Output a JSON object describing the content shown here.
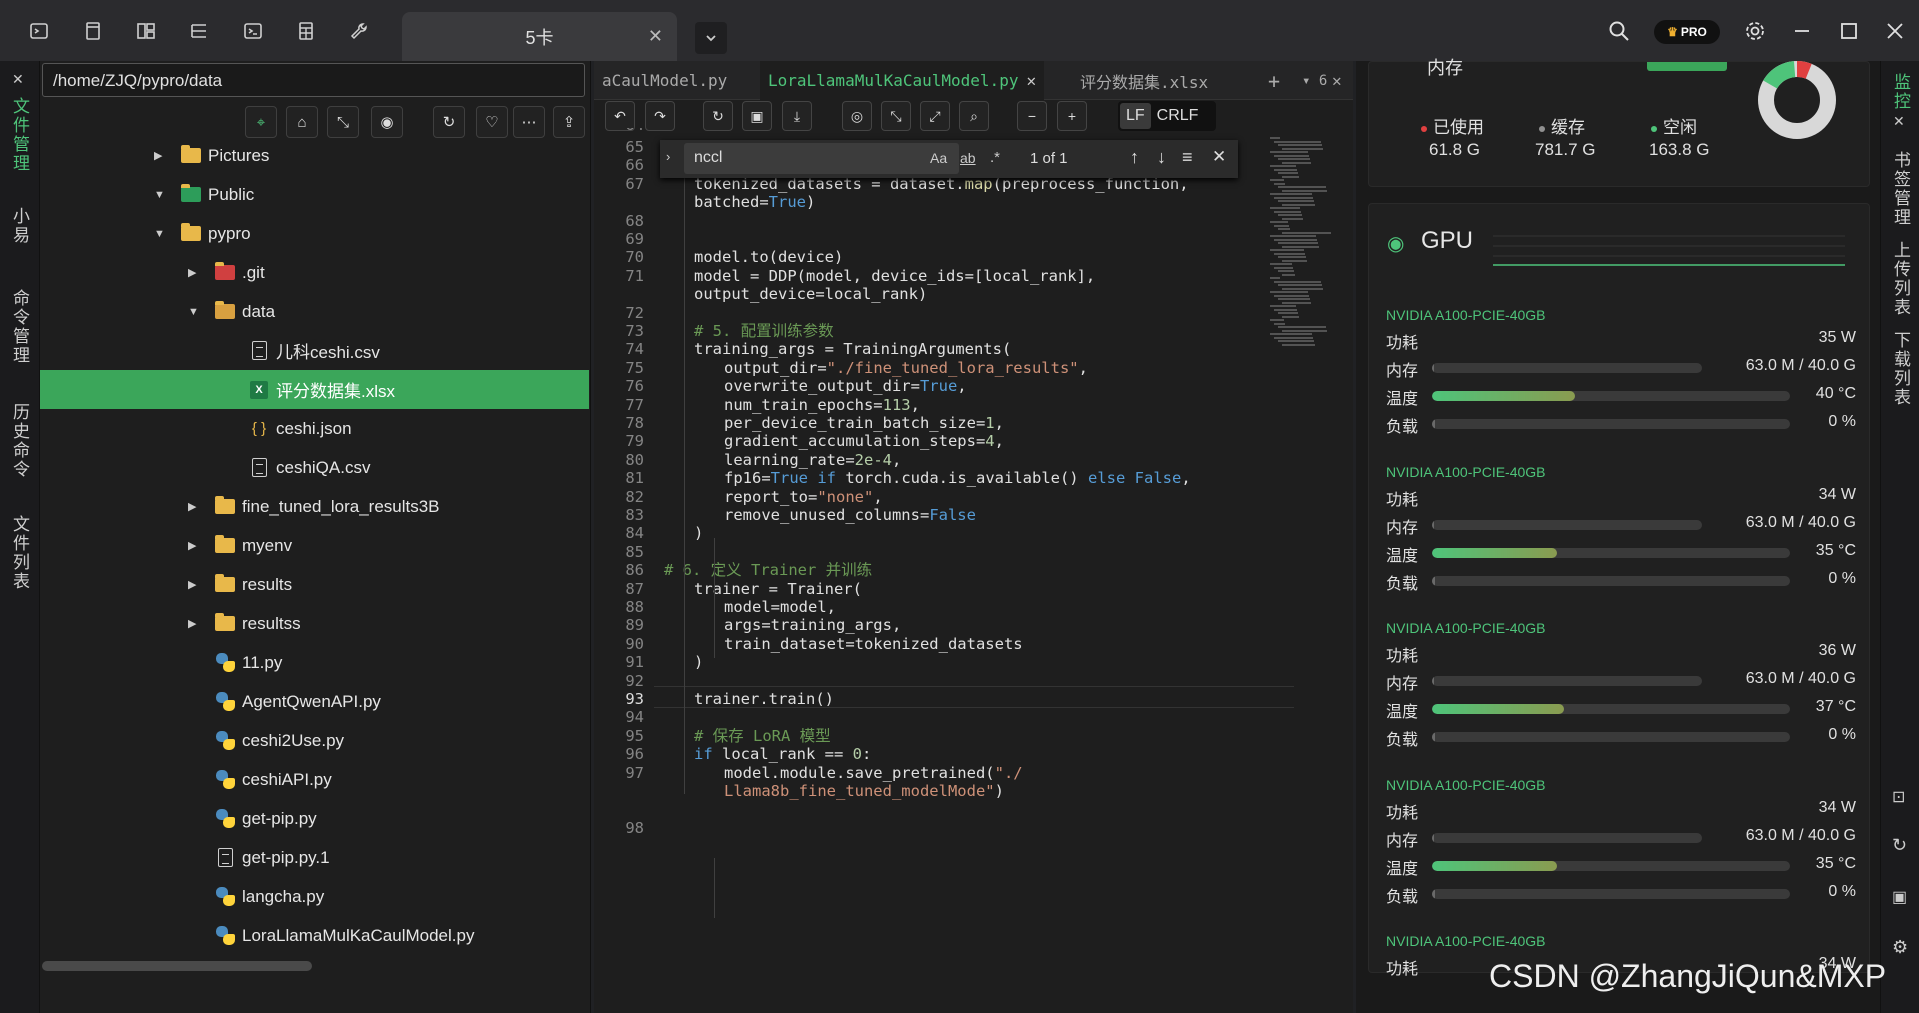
{
  "topbar": {
    "tab_title": "5卡",
    "pro_label": "PRO"
  },
  "left_rail": {
    "items": [
      "文件管理",
      "小易",
      "命令管理",
      "历史命令",
      "文件列表"
    ]
  },
  "right_rail": {
    "items": [
      "监控",
      "书签管理",
      "上传列表",
      "下载列表"
    ]
  },
  "file_panel": {
    "path": "/home/ZJQ/pypro/data",
    "tree": [
      {
        "name": "Pictures",
        "type": "folder",
        "depth": 1,
        "expander": "right"
      },
      {
        "name": "Public",
        "type": "folder-green",
        "depth": 1,
        "expander": "down"
      },
      {
        "name": "pypro",
        "type": "folder",
        "depth": 1,
        "expander": "down"
      },
      {
        "name": ".git",
        "type": "git",
        "depth": 2,
        "expander": "right"
      },
      {
        "name": "data",
        "type": "db",
        "depth": 2,
        "expander": "down"
      },
      {
        "name": "儿科ceshi.csv",
        "type": "doc",
        "depth": 3,
        "expander": ""
      },
      {
        "name": "评分数据集.xlsx",
        "type": "excel",
        "depth": 3,
        "expander": "",
        "selected": true
      },
      {
        "name": "ceshi.json",
        "type": "json",
        "depth": 3,
        "expander": ""
      },
      {
        "name": "ceshiQA.csv",
        "type": "doc",
        "depth": 3,
        "expander": ""
      },
      {
        "name": "fine_tuned_lora_results3B",
        "type": "folder",
        "depth": 2,
        "expander": "right"
      },
      {
        "name": "myenv",
        "type": "folder",
        "depth": 2,
        "expander": "right"
      },
      {
        "name": "results",
        "type": "folder",
        "depth": 2,
        "expander": "right"
      },
      {
        "name": "resultss",
        "type": "folder",
        "depth": 2,
        "expander": "right"
      },
      {
        "name": "11.py",
        "type": "py",
        "depth": 2,
        "expander": ""
      },
      {
        "name": "AgentQwenAPI.py",
        "type": "py",
        "depth": 2,
        "expander": ""
      },
      {
        "name": "ceshi2Use.py",
        "type": "py",
        "depth": 2,
        "expander": ""
      },
      {
        "name": "ceshiAPI.py",
        "type": "py",
        "depth": 2,
        "expander": ""
      },
      {
        "name": "get-pip.py",
        "type": "py",
        "depth": 2,
        "expander": ""
      },
      {
        "name": "get-pip.py.1",
        "type": "file",
        "depth": 2,
        "expander": ""
      },
      {
        "name": "langcha.py",
        "type": "py",
        "depth": 2,
        "expander": ""
      },
      {
        "name": "LoraLlamaMulKaCaulModel.py",
        "type": "py",
        "depth": 2,
        "expander": ""
      }
    ]
  },
  "editor": {
    "tabs": [
      "aCaulModel.py",
      "LoraLlamaMulKaCaulModel.py",
      "评分数据集.xlsx"
    ],
    "tab_count": "6",
    "line_ending": {
      "lf": "LF",
      "crlf": "CRLF"
    },
    "find": {
      "query": "nccl",
      "opt_case": "Aa",
      "opt_word": "ab",
      "opt_regex": ".*",
      "result": "1 of 1"
    },
    "first_partial_line": "64",
    "lines": [
      {
        "n": "65",
        "segs": []
      },
      {
        "n": "66",
        "segs": []
      },
      {
        "n": "67",
        "indent": 1,
        "segs": [
          [
            "tokenized_datasets = dataset.",
            ""
          ],
          [
            "map",
            "fn"
          ],
          [
            "(preprocess_function,",
            ""
          ]
        ]
      },
      {
        "n": "",
        "indent": 1,
        "segs": [
          [
            "batched=",
            ""
          ],
          [
            "True",
            "kw"
          ],
          [
            ")",
            ""
          ]
        ]
      },
      {
        "n": "68",
        "segs": []
      },
      {
        "n": "69",
        "segs": []
      },
      {
        "n": "70",
        "indent": 1,
        "segs": [
          [
            "model.to(device)",
            ""
          ]
        ]
      },
      {
        "n": "71",
        "indent": 1,
        "segs": [
          [
            "model = DDP(model, device_ids=[local_rank],",
            ""
          ]
        ]
      },
      {
        "n": "",
        "indent": 1,
        "segs": [
          [
            "output_device=local_rank)",
            ""
          ]
        ]
      },
      {
        "n": "72",
        "segs": []
      },
      {
        "n": "73",
        "indent": 1,
        "segs": [
          [
            "# 5. 配置训练参数",
            "cm"
          ]
        ]
      },
      {
        "n": "74",
        "indent": 1,
        "segs": [
          [
            "training_args = TrainingArguments(",
            ""
          ]
        ]
      },
      {
        "n": "75",
        "indent": 2,
        "segs": [
          [
            "output_dir=",
            ""
          ],
          [
            "\"./fine_tuned_lora_results\"",
            "st"
          ],
          [
            ",",
            ""
          ]
        ]
      },
      {
        "n": "76",
        "indent": 2,
        "segs": [
          [
            "overwrite_output_dir=",
            ""
          ],
          [
            "True",
            "kw"
          ],
          [
            ",",
            ""
          ]
        ]
      },
      {
        "n": "77",
        "indent": 2,
        "segs": [
          [
            "num_train_epochs=",
            ""
          ],
          [
            "113",
            "nm"
          ],
          [
            ",",
            ""
          ]
        ]
      },
      {
        "n": "78",
        "indent": 2,
        "segs": [
          [
            "per_device_train_batch_size=",
            ""
          ],
          [
            "1",
            "nm"
          ],
          [
            ",",
            ""
          ]
        ]
      },
      {
        "n": "79",
        "indent": 2,
        "segs": [
          [
            "gradient_accumulation_steps=",
            ""
          ],
          [
            "4",
            "nm"
          ],
          [
            ",",
            ""
          ]
        ]
      },
      {
        "n": "80",
        "indent": 2,
        "segs": [
          [
            "learning_rate=",
            ""
          ],
          [
            "2e-4",
            "nm"
          ],
          [
            ",",
            ""
          ]
        ]
      },
      {
        "n": "81",
        "indent": 2,
        "segs": [
          [
            "fp16=",
            ""
          ],
          [
            "True",
            "kw"
          ],
          [
            " ",
            ""
          ],
          [
            "if",
            "kw"
          ],
          [
            " torch.cuda.is_available() ",
            ""
          ],
          [
            "else",
            "kw"
          ],
          [
            " ",
            ""
          ],
          [
            "False",
            "kw"
          ],
          [
            ",",
            ""
          ]
        ]
      },
      {
        "n": "82",
        "indent": 2,
        "segs": [
          [
            "report_to=",
            ""
          ],
          [
            "\"none\"",
            "st"
          ],
          [
            ",",
            ""
          ]
        ]
      },
      {
        "n": "83",
        "indent": 2,
        "segs": [
          [
            "remove_unused_columns=",
            ""
          ],
          [
            "False",
            "kw"
          ]
        ]
      },
      {
        "n": "84",
        "indent": 1,
        "segs": [
          [
            ")",
            ""
          ]
        ]
      },
      {
        "n": "85",
        "segs": []
      },
      {
        "n": "86",
        "indent": 0,
        "segs": [
          [
            "# 6. 定义 Trainer 并训练",
            "cm"
          ]
        ]
      },
      {
        "n": "87",
        "indent": 1,
        "segs": [
          [
            "trainer = Trainer(",
            ""
          ]
        ]
      },
      {
        "n": "88",
        "indent": 2,
        "segs": [
          [
            "model=model,",
            ""
          ]
        ]
      },
      {
        "n": "89",
        "indent": 2,
        "segs": [
          [
            "args=training_args,",
            ""
          ]
        ]
      },
      {
        "n": "90",
        "indent": 2,
        "segs": [
          [
            "train_dataset=tokenized_datasets",
            ""
          ]
        ]
      },
      {
        "n": "91",
        "indent": 1,
        "segs": [
          [
            ")",
            ""
          ]
        ]
      },
      {
        "n": "92",
        "segs": []
      },
      {
        "n": "93",
        "indent": 1,
        "current": true,
        "segs": [
          [
            "trainer.train()",
            ""
          ]
        ]
      },
      {
        "n": "94",
        "segs": []
      },
      {
        "n": "95",
        "indent": 1,
        "segs": [
          [
            "# 保存 LoRA 模型",
            "cm"
          ]
        ]
      },
      {
        "n": "96",
        "indent": 1,
        "segs": [
          [
            "if",
            "kw"
          ],
          [
            " local_rank == ",
            ""
          ],
          [
            "0",
            "nm"
          ],
          [
            ":",
            ""
          ]
        ]
      },
      {
        "n": "97",
        "indent": 2,
        "segs": [
          [
            "model.module.save_pretrained(",
            ""
          ],
          [
            "\"./",
            "st"
          ]
        ]
      },
      {
        "n": "",
        "indent": 2,
        "segs": [
          [
            "Llama8b_fine_tuned_modelMode\"",
            "st"
          ],
          [
            ")",
            ""
          ]
        ]
      },
      {
        "n": "",
        "segs": []
      },
      {
        "n": "98",
        "segs": []
      }
    ]
  },
  "monitor": {
    "mem_title": "内存",
    "used_label": "已使用",
    "used": "61.8 G",
    "cache_label": "缓存",
    "cache": "781.7 G",
    "free_label": "空闲",
    "free": "163.8 G",
    "colors": {
      "used": "#e04040",
      "cache": "#909090",
      "free": "#4ec47a"
    },
    "gpu_title": "GPU",
    "labels": {
      "power": "功耗",
      "mem": "内存",
      "temp": "温度",
      "load": "负载"
    },
    "gpus": [
      {
        "name": "NVIDIA A100-PCIE-40GB",
        "power": "35 W",
        "mem": "63.0 M / 40.0 G",
        "mem_frac": 0.0015,
        "temp": "40 °C",
        "temp_frac": 0.4,
        "load": "0 %",
        "load_frac": 0
      },
      {
        "name": "NVIDIA A100-PCIE-40GB",
        "power": "34 W",
        "mem": "63.0 M / 40.0 G",
        "mem_frac": 0.0015,
        "temp": "35 °C",
        "temp_frac": 0.35,
        "load": "0 %",
        "load_frac": 0
      },
      {
        "name": "NVIDIA A100-PCIE-40GB",
        "power": "36 W",
        "mem": "63.0 M / 40.0 G",
        "mem_frac": 0.0015,
        "temp": "37 °C",
        "temp_frac": 0.37,
        "load": "0 %",
        "load_frac": 0
      },
      {
        "name": "NVIDIA A100-PCIE-40GB",
        "power": "34 W",
        "mem": "63.0 M / 40.0 G",
        "mem_frac": 0.0015,
        "temp": "35 °C",
        "temp_frac": 0.35,
        "load": "0 %",
        "load_frac": 0
      },
      {
        "name": "NVIDIA A100-PCIE-40GB",
        "power": "34 W"
      }
    ]
  },
  "watermark": "CSDN @ZhangJiQun&MXP"
}
